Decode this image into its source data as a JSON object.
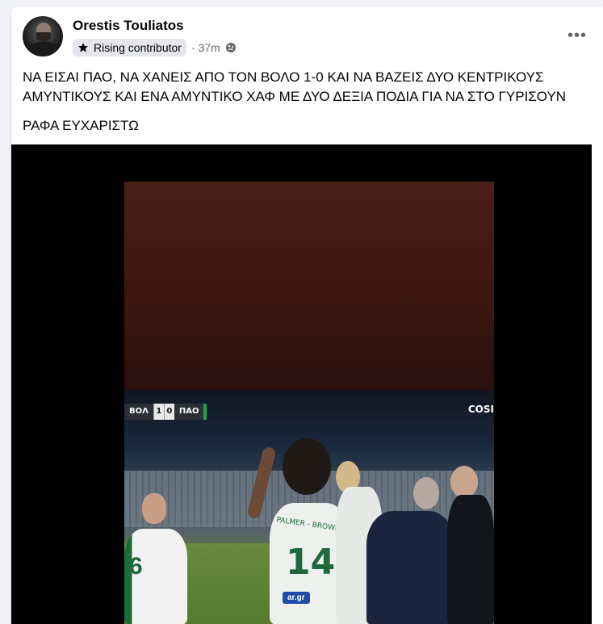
{
  "post": {
    "author": "Orestis Touliatos",
    "badge": "Rising contributor",
    "separator": "·",
    "time": "37m",
    "audience_icon": "globe-icon",
    "more_label": "•••",
    "text_line1": "ΝΑ ΕΙΣΑΙ ΠΑΟ, ΝΑ ΧΑΝΕΙΣ ΑΠΟ ΤΟΝ ΒΟΛΟ 1-0 ΚΑΙ ΝΑ ΒΑΖΕΙΣ ΔΥΟ ΚΕΝΤΡΙΚΟΥΣ ΑΜΥΝΤΙΚΟΥΣ ΚΑΙ ΕΝΑ ΑΜΥΝΤΙΚΟ ΧΑΦ ΜΕ ΔΥΟ ΔΕΞΙΑ ΠΟΔΙΑ ΓΙΑ ΝΑ ΣΤΟ ΓΥΡΙΣΟΥΝ",
    "text_line2": "ΡΑΦΑ ΕΥΧΑΡΙΣΤΩ"
  },
  "video": {
    "scoreboard": {
      "home": "ΒΟΛ",
      "home_score": "1",
      "away_score": "0",
      "away": "ΠΑΟ"
    },
    "broadcaster": "COSI",
    "player_left_number": "6",
    "player_center_number": "14",
    "player_center_name": "PALMER - BROWN",
    "sponsor": "ar.gr"
  }
}
